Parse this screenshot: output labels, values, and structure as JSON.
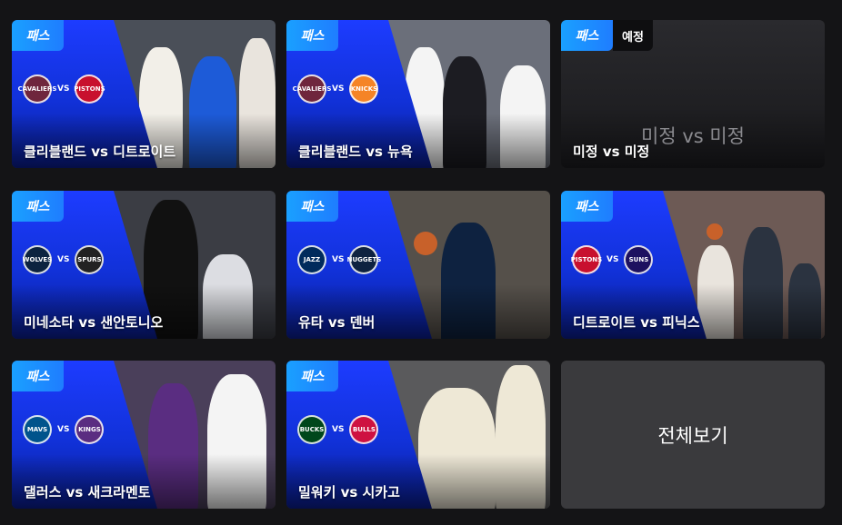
{
  "badges": {
    "pass": "패스",
    "scheduled": "예정"
  },
  "cards": [
    {
      "title": "클리블랜드 vs 디트로이트",
      "home": "CAVALIERS",
      "away": "PISTONS",
      "home_color": "#6f263d",
      "away_color": "#c8102e",
      "photo_bg": "#4a4f58",
      "jersey_a": "#f2efe8",
      "jersey_b": "#1d5bd8"
    },
    {
      "title": "클리블랜드 vs 뉴욕",
      "home": "CAVALIERS",
      "away": "KNICKS",
      "home_color": "#6f263d",
      "away_color": "#f58426",
      "photo_bg": "#6b6f7a",
      "jersey_a": "#1c1c22",
      "jersey_b": "#f4f4f4"
    },
    {
      "title": "미정 vs 미정",
      "center": "미정 vs 미정"
    },
    {
      "title": "미네소타 vs 샌안토니오",
      "home": "WOLVES",
      "away": "SPURS",
      "home_color": "#0c2340",
      "away_color": "#222",
      "photo_bg": "#3b3d44",
      "jersey_a": "#111",
      "jersey_b": "#dcdde2"
    },
    {
      "title": "유타 vs 덴버",
      "home": "JAZZ",
      "away": "NUGGETS",
      "home_color": "#002b5c",
      "away_color": "#0e2240",
      "photo_bg": "#55504a",
      "jersey_a": "#0e2240",
      "jersey_b": "#7a5a3a"
    },
    {
      "title": "디트로이트 vs 피닉스",
      "home": "PISTONS",
      "away": "SUNS",
      "home_color": "#c8102e",
      "away_color": "#1d1160",
      "photo_bg": "#6d5a55",
      "jersey_a": "#e9e4dd",
      "jersey_b": "#2b3340"
    },
    {
      "title": "댈러스 vs 새크라멘토",
      "home": "MAVS",
      "away": "KINGS",
      "home_color": "#00538c",
      "away_color": "#5a2d81",
      "photo_bg": "#4a3f5a",
      "jersey_a": "#5a2d81",
      "jersey_b": "#f4f4f4"
    },
    {
      "title": "밀워키 vs 시카고",
      "home": "BUCKS",
      "away": "BULLS",
      "home_color": "#00471b",
      "away_color": "#ce1141",
      "photo_bg": "#5a5a5c",
      "jersey_a": "#eee8d6",
      "jersey_b": "#a08a6a"
    }
  ],
  "view_all": "전체보기",
  "small_vs": "VS"
}
